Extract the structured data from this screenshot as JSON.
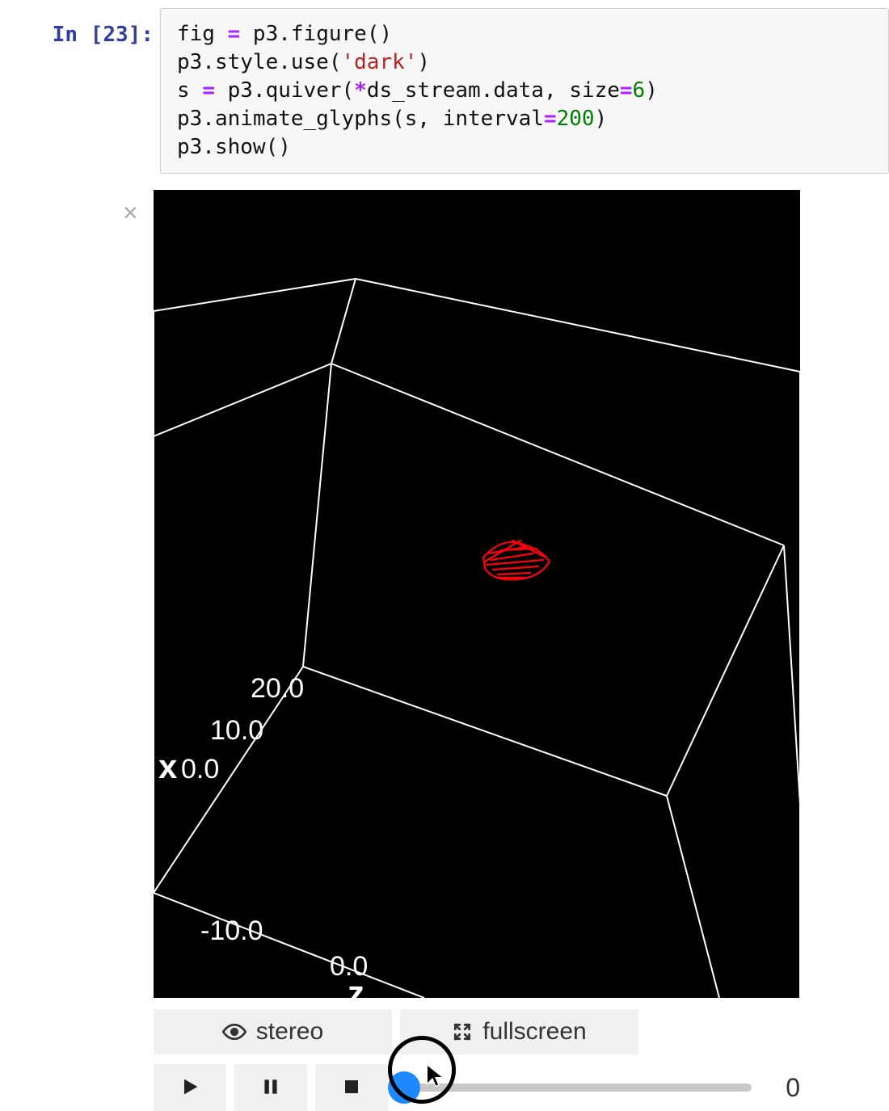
{
  "cell": {
    "prompt": "In [23]:",
    "code": {
      "l1_a": "fig ",
      "l1_eq": "=",
      "l1_b": " p3.figure()",
      "l2_a": "p3.style.use(",
      "l2_str": "'dark'",
      "l2_b": ")",
      "l3_a": "s ",
      "l3_eq": "=",
      "l3_b": " p3.quiver(",
      "l3_star": "*",
      "l3_c": "ds_stream.data, size",
      "l3_eq2": "=",
      "l3_num": "6",
      "l3_d": ")",
      "l4_a": "p3.animate_glyphs(s, interval",
      "l4_eq": "=",
      "l4_num": "200",
      "l4_b": ")",
      "l5_a": "p3.show()"
    }
  },
  "output": {
    "close": "×",
    "axis": {
      "x_name": "x",
      "x_t0": "0.0",
      "x_t10": "10.0",
      "x_t20": "20.0",
      "y_neg10": "-10.0",
      "z_name": "z",
      "z_t0": "0.0"
    }
  },
  "toolbar": {
    "stereo": "stereo",
    "fullscreen": "fullscreen"
  },
  "player": {
    "value": "0"
  }
}
